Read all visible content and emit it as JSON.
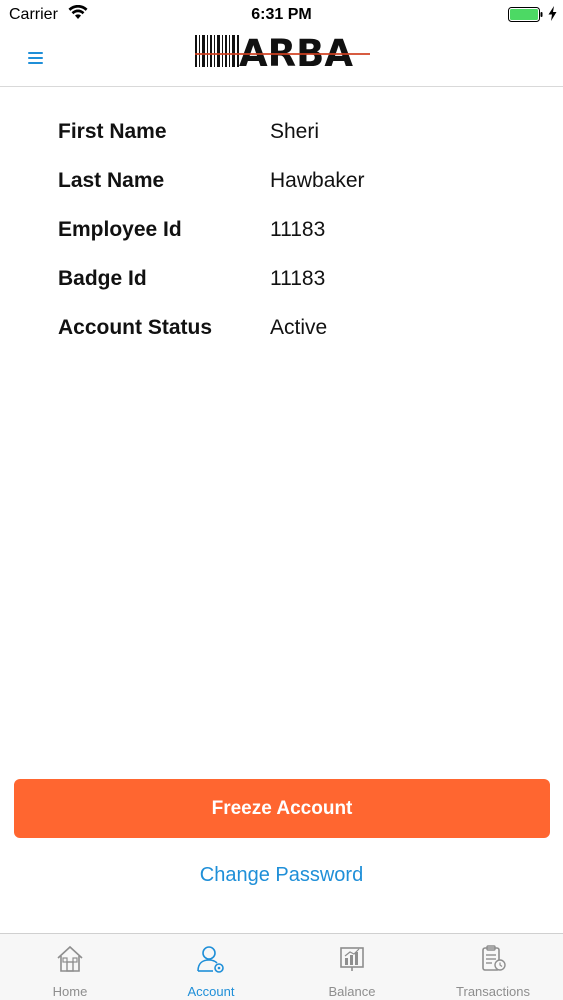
{
  "status_bar": {
    "carrier": "Carrier",
    "time": "6:31 PM",
    "icons": [
      "wifi-icon",
      "battery-icon",
      "charging-bolt-icon"
    ]
  },
  "header": {
    "logo_text": "ARBA",
    "icons": [
      "hamburger-menu-icon",
      "barcode-logo"
    ]
  },
  "account_info": [
    {
      "label": "First Name",
      "value": "Sheri"
    },
    {
      "label": "Last Name",
      "value": "Hawbaker"
    },
    {
      "label": "Employee Id",
      "value": "11183"
    },
    {
      "label": "Badge Id",
      "value": "11183"
    },
    {
      "label": "Account Status",
      "value": "Active"
    }
  ],
  "actions": {
    "freeze_label": "Freeze Account",
    "change_password_label": "Change Password"
  },
  "tab_bar": {
    "tabs": [
      {
        "label": "Home",
        "icon": "home-icon",
        "active": false
      },
      {
        "label": "Account",
        "icon": "account-icon",
        "active": true
      },
      {
        "label": "Balance",
        "icon": "balance-chart-icon",
        "active": false
      },
      {
        "label": "Transactions",
        "icon": "transactions-icon",
        "active": false
      }
    ]
  },
  "colors": {
    "accent": "#1f8fd8",
    "freeze_button": "#ff6630",
    "battery_fill": "#4cd964",
    "inactive_tab": "#8e8e8e"
  }
}
